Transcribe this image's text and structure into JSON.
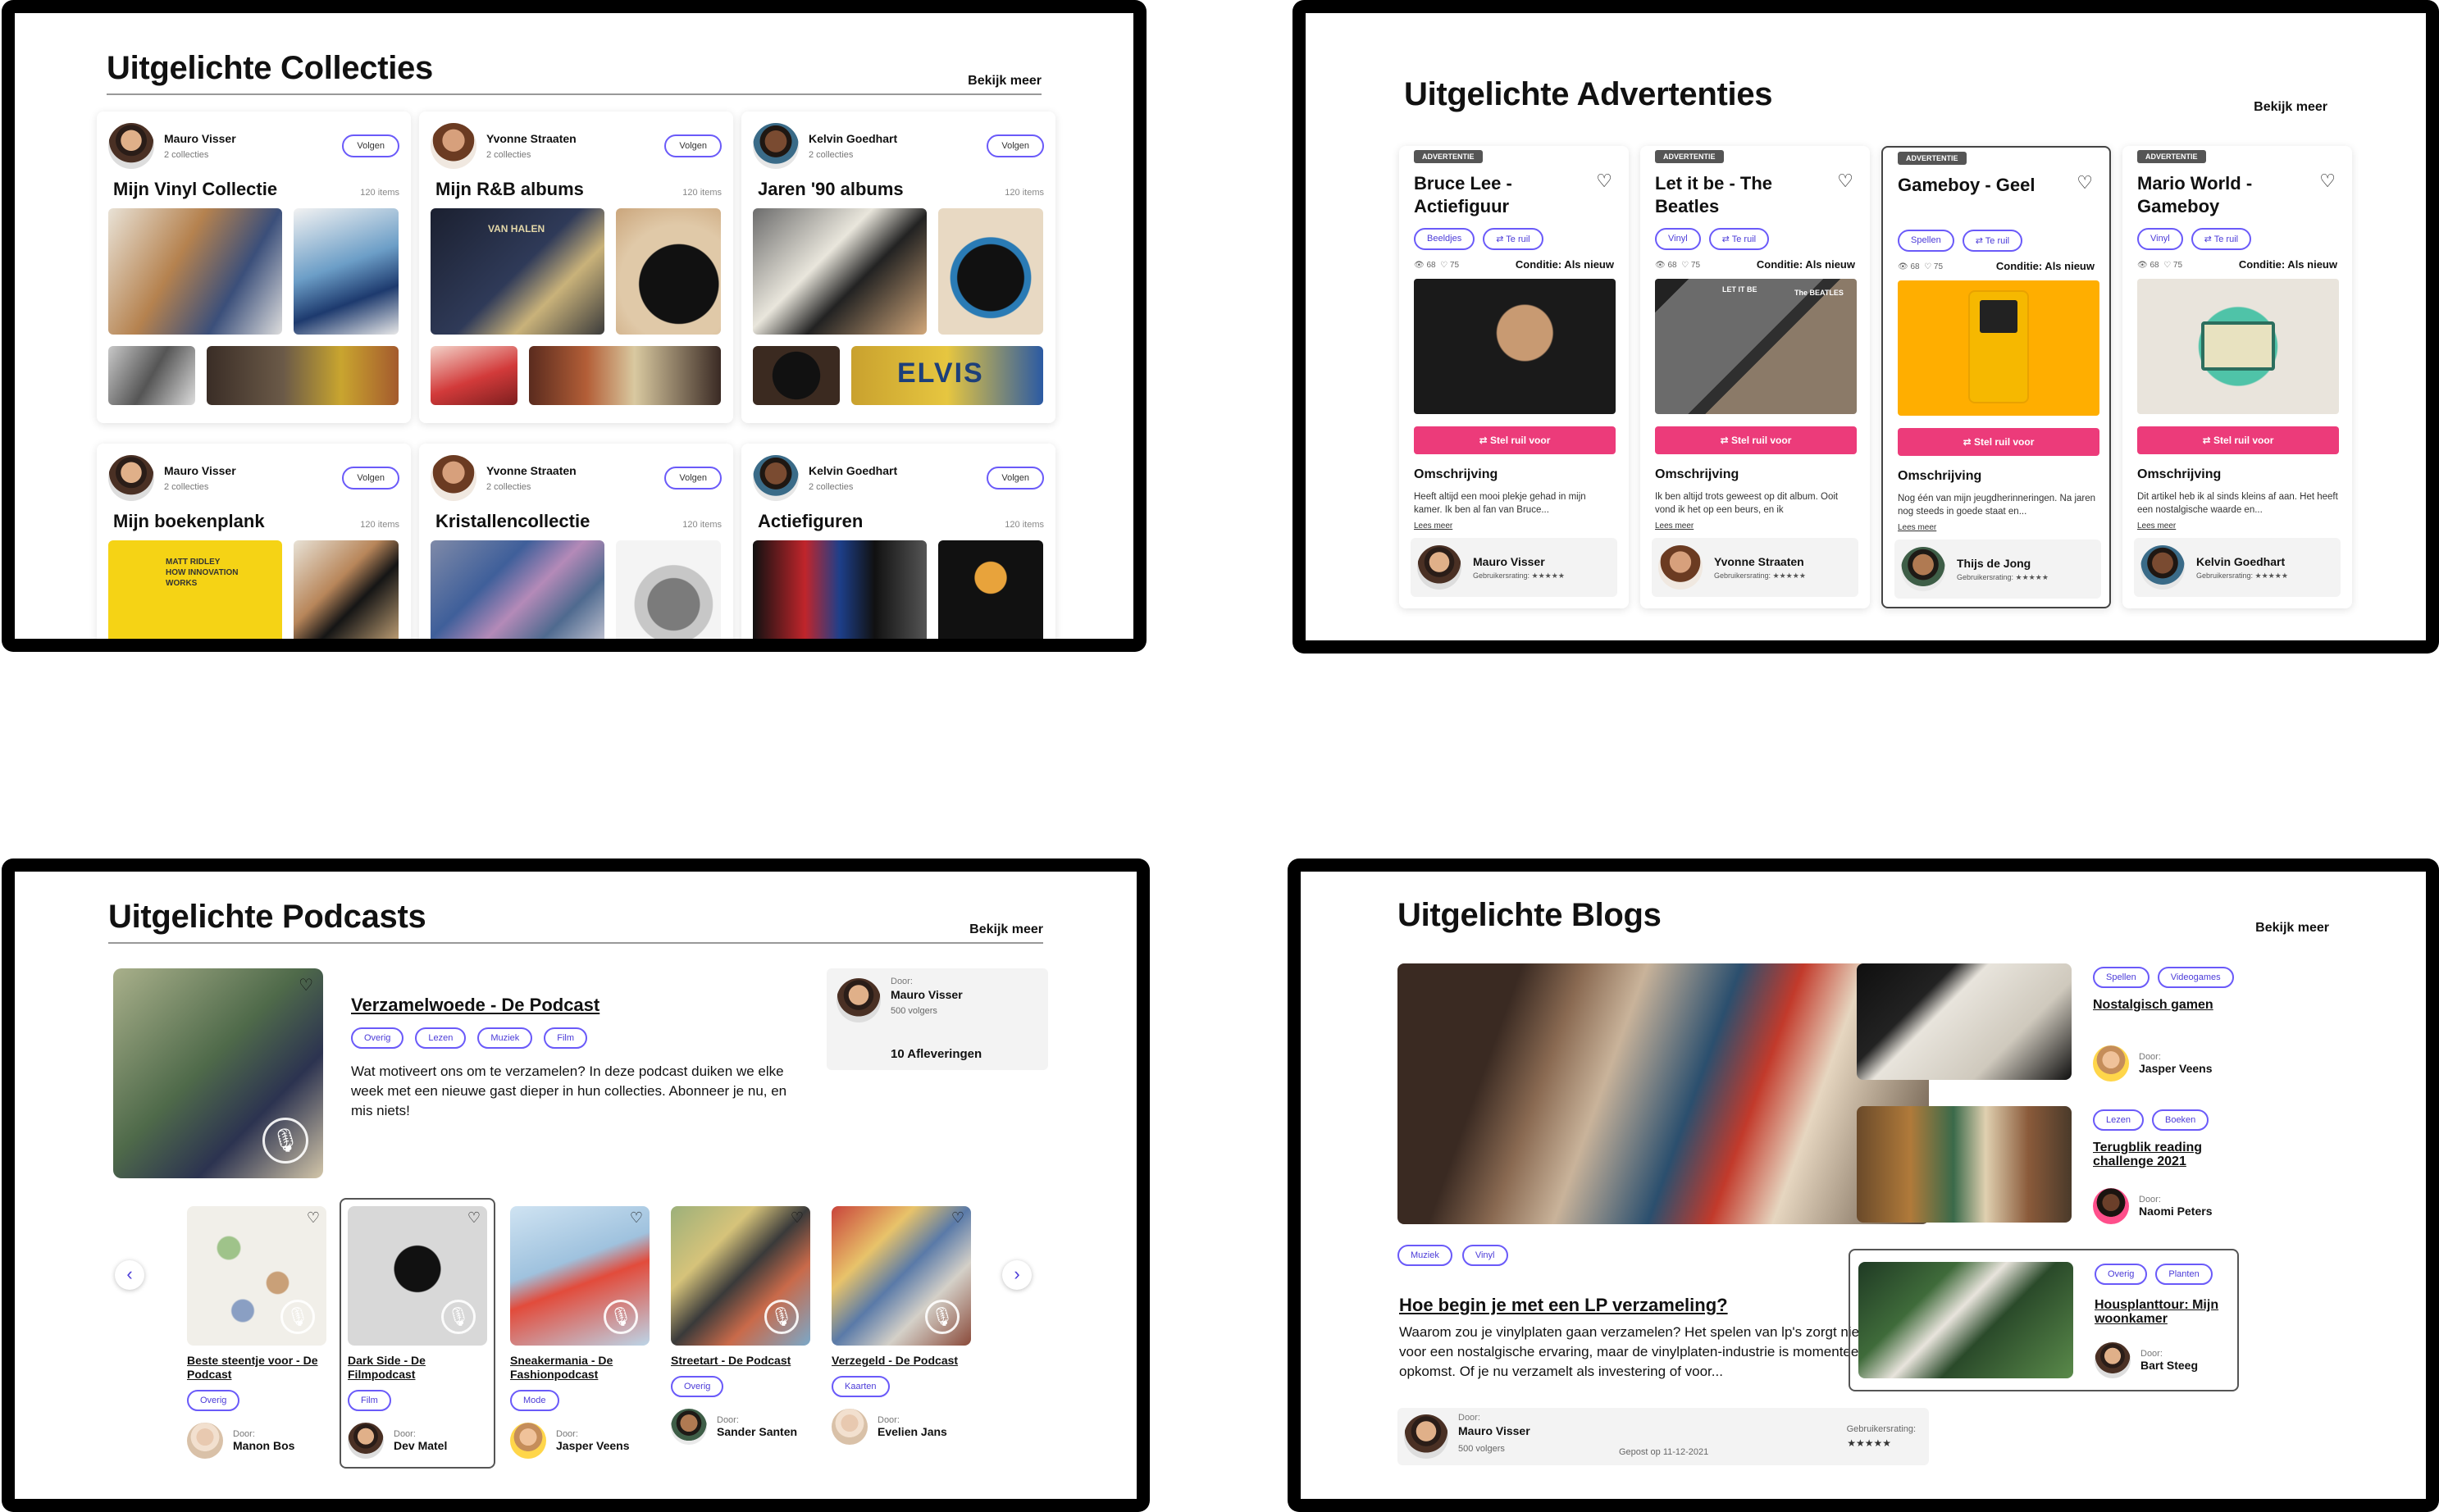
{
  "collections": {
    "title": "Uitgelichte Collecties",
    "more": "Bekijk meer",
    "follow": "Volgen",
    "cards": [
      {
        "owner": "Mauro Visser",
        "count": "2 collecties",
        "title": "Mijn Vinyl Collectie",
        "items": "120 items"
      },
      {
        "owner": "Yvonne Straaten",
        "count": "2 collecties",
        "title": "Mijn R&B albums",
        "items": "120 items"
      },
      {
        "owner": "Kelvin Goedhart",
        "count": "2 collecties",
        "title": "Jaren '90 albums",
        "items": "120 items"
      },
      {
        "owner": "Mauro Visser",
        "count": "2 collecties",
        "title": "Mijn boekenplank",
        "items": "120 items"
      },
      {
        "owner": "Yvonne Straaten",
        "count": "2 collecties",
        "title": "Kristallencollectie",
        "items": "120 items"
      },
      {
        "owner": "Kelvin Goedhart",
        "count": "2 collecties",
        "title": "Actiefiguren",
        "items": "120 items"
      }
    ],
    "image_text": {
      "book": "MATT RIDLEY HOW INNOVATION WORKS",
      "elvis": "ELVIS",
      "vanhalen": "VAN HALEN"
    }
  },
  "ads": {
    "title": "Uitgelichte Advertenties",
    "more": "Bekijk meer",
    "tag": "ADVERTENTIE",
    "button": "Stel ruil voor",
    "desc_heading": "Omschrijving",
    "read_more": "Lees meer",
    "condition": "Conditie: Als nieuw",
    "rating_label": "Gebruikersrating:",
    "stars": "★★★★★",
    "trade_label": "Te ruil",
    "views": "68",
    "likes": "75",
    "cards": [
      {
        "title": "Bruce Lee - Actiefiguur",
        "category": "Beeldjes",
        "desc": "Heeft altijd een mooi plekje gehad in mijn kamer. Ik ben al fan van Bruce...",
        "user": "Mauro Visser",
        "selected": false
      },
      {
        "title": "Let it be - The Beatles",
        "category": "Vinyl",
        "desc": "Ik ben altijd trots geweest op dit album. Ooit vond ik het op een beurs, en ik",
        "user": "Yvonne Straaten",
        "selected": false
      },
      {
        "title": "Gameboy - Geel",
        "category": "Spellen",
        "desc": "Nog één van mijn jeugdherinneringen. Na jaren nog steeds in goede staat en...",
        "user": "Thijs de Jong",
        "selected": true
      },
      {
        "title": "Mario World - Gameboy",
        "category": "Vinyl",
        "desc": "Dit artikel heb ik al sinds kleins af aan. Het heeft een nostalgische waarde en...",
        "user": "Kelvin Goedhart",
        "selected": false
      }
    ],
    "image_text": {
      "letitbe": "LET IT BE",
      "beatles": "The BEATLES"
    }
  },
  "podcasts": {
    "title": "Uitgelichte Podcasts",
    "more": "Bekijk meer",
    "featured": {
      "title": "Verzamelwoede - De Podcast",
      "tags": [
        "Overig",
        "Lezen",
        "Muziek",
        "Film"
      ],
      "desc": "Wat motiveert ons om te verzamelen? In deze podcast duiken we elke week met een nieuwe gast dieper in hun collecties. Abonneer je nu, en mis niets!",
      "by_label": "Door:",
      "by": "Mauro Visser",
      "followers": "500 volgers",
      "episodes": "10 Afleveringen"
    },
    "items": [
      {
        "title": "Beste steentje voor - De Podcast",
        "tag": "Overig",
        "by": "Manon Bos"
      },
      {
        "title": "Dark Side - De Filmpodcast",
        "tag": "Film",
        "by": "Dev Matel"
      },
      {
        "title": "Sneakermania - De Fashionpodcast",
        "tag": "Mode",
        "by": "Jasper Veens"
      },
      {
        "title": "Streetart - De Podcast",
        "tag": "Overig",
        "by": "Sander Santen"
      },
      {
        "title": "Verzegeld - De Podcast",
        "tag": "Kaarten",
        "by": "Evelien Jans"
      }
    ],
    "by_label": "Door:"
  },
  "blogs": {
    "title": "Uitgelichte Blogs",
    "more": "Bekijk meer",
    "main": {
      "tags": [
        "Muziek",
        "Vinyl"
      ],
      "title": "Hoe begin je met een LP verzameling?",
      "desc": "Waarom zou je vinylplaten gaan verzamelen? Het spelen van lp's zorgt niet alleen voor een nostalgische ervaring, maar de vinylplaten-industrie is momenteel in opkomst. Of je nu verzamelt als investering of voor...",
      "by_label": "Door:",
      "by": "Mauro Visser",
      "followers": "500 volgers",
      "posted": "Gepost op 11-12-2021",
      "rating_label": "Gebruikersrating:",
      "stars": "★★★★★"
    },
    "side": [
      {
        "tags": [
          "Spellen",
          "Videogames"
        ],
        "title": "Nostalgisch gamen",
        "by": "Jasper Veens"
      },
      {
        "tags": [
          "Lezen",
          "Boeken"
        ],
        "title": "Terugblik reading challenge 2021",
        "by": "Naomi Peters"
      },
      {
        "tags": [
          "Overig",
          "Planten"
        ],
        "title": "Housplanttour: Mijn woonkamer",
        "by": "Bart Steeg"
      }
    ],
    "by_label": "Door:"
  }
}
